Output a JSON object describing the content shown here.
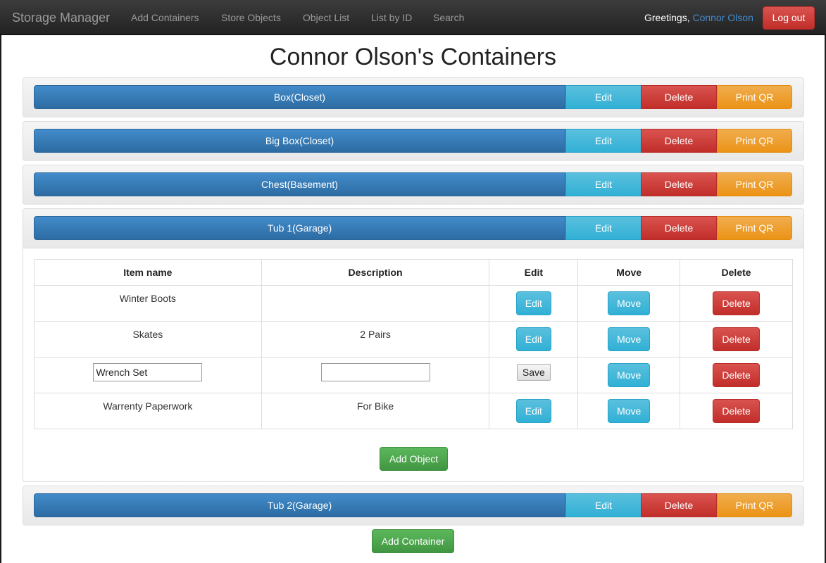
{
  "navbar": {
    "brand": "Storage Manager",
    "links": [
      "Add Containers",
      "Store Objects",
      "Object List",
      "List by ID",
      "Search"
    ],
    "greeting_prefix": "Greetings, ",
    "username": "Connor Olson",
    "logout_label": "Log out"
  },
  "page_title": "Connor Olson's Containers",
  "container_actions": {
    "edit": "Edit",
    "delete": "Delete",
    "print_qr": "Print QR"
  },
  "containers": [
    {
      "name": "Box(Closet)"
    },
    {
      "name": "Big Box(Closet)"
    },
    {
      "name": "Chest(Basement)"
    },
    {
      "name": "Tub 1(Garage)"
    },
    {
      "name": "Tub 2(Garage)"
    }
  ],
  "expanded_container": {
    "columns": [
      "Item name",
      "Description",
      "Edit",
      "Move",
      "Delete"
    ],
    "rows": [
      {
        "name": "Winter Boots",
        "description": ""
      },
      {
        "name": "Skates",
        "description": "2 Pairs"
      },
      {
        "name": "Wrench Set",
        "description": "",
        "editing": true
      },
      {
        "name": "Warrenty Paperwork",
        "description": "For Bike"
      }
    ],
    "edit_label": "Edit",
    "save_label": "Save",
    "move_label": "Move",
    "delete_label": "Delete",
    "add_object_label": "Add Object"
  },
  "add_container_label": "Add Container",
  "colors": {
    "primary": "#428bca",
    "info": "#5bc0de",
    "danger": "#d9534f",
    "warning": "#f0ad4e",
    "success": "#5cb85c",
    "navbar": "#222222"
  }
}
